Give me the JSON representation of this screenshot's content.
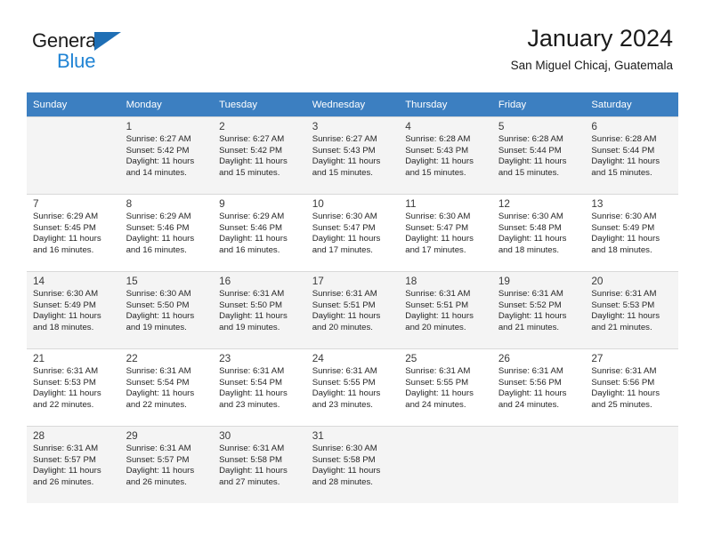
{
  "brand": {
    "name_top": "General",
    "name_bottom": "Blue",
    "triangle_color": "#1f6fb5",
    "blue_color": "#1f83d4"
  },
  "header": {
    "title": "January 2024",
    "subtitle": "San Miguel Chicaj, Guatemala"
  },
  "colors": {
    "header_row_bg": "#3c7fc1",
    "header_row_text": "#ffffff",
    "shaded_row_bg": "#f4f4f4",
    "grid_line": "#d9d9d9"
  },
  "weekdays": [
    "Sunday",
    "Monday",
    "Tuesday",
    "Wednesday",
    "Thursday",
    "Friday",
    "Saturday"
  ],
  "labels": {
    "sunrise_prefix": "Sunrise:",
    "sunset_prefix": "Sunset:",
    "daylight_prefix": "Daylight:"
  },
  "weeks": [
    {
      "shaded": true,
      "days": [
        {
          "num": "",
          "sunrise": "",
          "sunset": "",
          "daylight_line1": "",
          "daylight_line2": ""
        },
        {
          "num": "1",
          "sunrise": "Sunrise: 6:27 AM",
          "sunset": "Sunset: 5:42 PM",
          "daylight_line1": "Daylight: 11 hours",
          "daylight_line2": "and 14 minutes."
        },
        {
          "num": "2",
          "sunrise": "Sunrise: 6:27 AM",
          "sunset": "Sunset: 5:42 PM",
          "daylight_line1": "Daylight: 11 hours",
          "daylight_line2": "and 15 minutes."
        },
        {
          "num": "3",
          "sunrise": "Sunrise: 6:27 AM",
          "sunset": "Sunset: 5:43 PM",
          "daylight_line1": "Daylight: 11 hours",
          "daylight_line2": "and 15 minutes."
        },
        {
          "num": "4",
          "sunrise": "Sunrise: 6:28 AM",
          "sunset": "Sunset: 5:43 PM",
          "daylight_line1": "Daylight: 11 hours",
          "daylight_line2": "and 15 minutes."
        },
        {
          "num": "5",
          "sunrise": "Sunrise: 6:28 AM",
          "sunset": "Sunset: 5:44 PM",
          "daylight_line1": "Daylight: 11 hours",
          "daylight_line2": "and 15 minutes."
        },
        {
          "num": "6",
          "sunrise": "Sunrise: 6:28 AM",
          "sunset": "Sunset: 5:44 PM",
          "daylight_line1": "Daylight: 11 hours",
          "daylight_line2": "and 15 minutes."
        }
      ]
    },
    {
      "shaded": false,
      "days": [
        {
          "num": "7",
          "sunrise": "Sunrise: 6:29 AM",
          "sunset": "Sunset: 5:45 PM",
          "daylight_line1": "Daylight: 11 hours",
          "daylight_line2": "and 16 minutes."
        },
        {
          "num": "8",
          "sunrise": "Sunrise: 6:29 AM",
          "sunset": "Sunset: 5:46 PM",
          "daylight_line1": "Daylight: 11 hours",
          "daylight_line2": "and 16 minutes."
        },
        {
          "num": "9",
          "sunrise": "Sunrise: 6:29 AM",
          "sunset": "Sunset: 5:46 PM",
          "daylight_line1": "Daylight: 11 hours",
          "daylight_line2": "and 16 minutes."
        },
        {
          "num": "10",
          "sunrise": "Sunrise: 6:30 AM",
          "sunset": "Sunset: 5:47 PM",
          "daylight_line1": "Daylight: 11 hours",
          "daylight_line2": "and 17 minutes."
        },
        {
          "num": "11",
          "sunrise": "Sunrise: 6:30 AM",
          "sunset": "Sunset: 5:47 PM",
          "daylight_line1": "Daylight: 11 hours",
          "daylight_line2": "and 17 minutes."
        },
        {
          "num": "12",
          "sunrise": "Sunrise: 6:30 AM",
          "sunset": "Sunset: 5:48 PM",
          "daylight_line1": "Daylight: 11 hours",
          "daylight_line2": "and 18 minutes."
        },
        {
          "num": "13",
          "sunrise": "Sunrise: 6:30 AM",
          "sunset": "Sunset: 5:49 PM",
          "daylight_line1": "Daylight: 11 hours",
          "daylight_line2": "and 18 minutes."
        }
      ]
    },
    {
      "shaded": true,
      "days": [
        {
          "num": "14",
          "sunrise": "Sunrise: 6:30 AM",
          "sunset": "Sunset: 5:49 PM",
          "daylight_line1": "Daylight: 11 hours",
          "daylight_line2": "and 18 minutes."
        },
        {
          "num": "15",
          "sunrise": "Sunrise: 6:30 AM",
          "sunset": "Sunset: 5:50 PM",
          "daylight_line1": "Daylight: 11 hours",
          "daylight_line2": "and 19 minutes."
        },
        {
          "num": "16",
          "sunrise": "Sunrise: 6:31 AM",
          "sunset": "Sunset: 5:50 PM",
          "daylight_line1": "Daylight: 11 hours",
          "daylight_line2": "and 19 minutes."
        },
        {
          "num": "17",
          "sunrise": "Sunrise: 6:31 AM",
          "sunset": "Sunset: 5:51 PM",
          "daylight_line1": "Daylight: 11 hours",
          "daylight_line2": "and 20 minutes."
        },
        {
          "num": "18",
          "sunrise": "Sunrise: 6:31 AM",
          "sunset": "Sunset: 5:51 PM",
          "daylight_line1": "Daylight: 11 hours",
          "daylight_line2": "and 20 minutes."
        },
        {
          "num": "19",
          "sunrise": "Sunrise: 6:31 AM",
          "sunset": "Sunset: 5:52 PM",
          "daylight_line1": "Daylight: 11 hours",
          "daylight_line2": "and 21 minutes."
        },
        {
          "num": "20",
          "sunrise": "Sunrise: 6:31 AM",
          "sunset": "Sunset: 5:53 PM",
          "daylight_line1": "Daylight: 11 hours",
          "daylight_line2": "and 21 minutes."
        }
      ]
    },
    {
      "shaded": false,
      "days": [
        {
          "num": "21",
          "sunrise": "Sunrise: 6:31 AM",
          "sunset": "Sunset: 5:53 PM",
          "daylight_line1": "Daylight: 11 hours",
          "daylight_line2": "and 22 minutes."
        },
        {
          "num": "22",
          "sunrise": "Sunrise: 6:31 AM",
          "sunset": "Sunset: 5:54 PM",
          "daylight_line1": "Daylight: 11 hours",
          "daylight_line2": "and 22 minutes."
        },
        {
          "num": "23",
          "sunrise": "Sunrise: 6:31 AM",
          "sunset": "Sunset: 5:54 PM",
          "daylight_line1": "Daylight: 11 hours",
          "daylight_line2": "and 23 minutes."
        },
        {
          "num": "24",
          "sunrise": "Sunrise: 6:31 AM",
          "sunset": "Sunset: 5:55 PM",
          "daylight_line1": "Daylight: 11 hours",
          "daylight_line2": "and 23 minutes."
        },
        {
          "num": "25",
          "sunrise": "Sunrise: 6:31 AM",
          "sunset": "Sunset: 5:55 PM",
          "daylight_line1": "Daylight: 11 hours",
          "daylight_line2": "and 24 minutes."
        },
        {
          "num": "26",
          "sunrise": "Sunrise: 6:31 AM",
          "sunset": "Sunset: 5:56 PM",
          "daylight_line1": "Daylight: 11 hours",
          "daylight_line2": "and 24 minutes."
        },
        {
          "num": "27",
          "sunrise": "Sunrise: 6:31 AM",
          "sunset": "Sunset: 5:56 PM",
          "daylight_line1": "Daylight: 11 hours",
          "daylight_line2": "and 25 minutes."
        }
      ]
    },
    {
      "shaded": true,
      "days": [
        {
          "num": "28",
          "sunrise": "Sunrise: 6:31 AM",
          "sunset": "Sunset: 5:57 PM",
          "daylight_line1": "Daylight: 11 hours",
          "daylight_line2": "and 26 minutes."
        },
        {
          "num": "29",
          "sunrise": "Sunrise: 6:31 AM",
          "sunset": "Sunset: 5:57 PM",
          "daylight_line1": "Daylight: 11 hours",
          "daylight_line2": "and 26 minutes."
        },
        {
          "num": "30",
          "sunrise": "Sunrise: 6:31 AM",
          "sunset": "Sunset: 5:58 PM",
          "daylight_line1": "Daylight: 11 hours",
          "daylight_line2": "and 27 minutes."
        },
        {
          "num": "31",
          "sunrise": "Sunrise: 6:30 AM",
          "sunset": "Sunset: 5:58 PM",
          "daylight_line1": "Daylight: 11 hours",
          "daylight_line2": "and 28 minutes."
        },
        {
          "num": "",
          "sunrise": "",
          "sunset": "",
          "daylight_line1": "",
          "daylight_line2": ""
        },
        {
          "num": "",
          "sunrise": "",
          "sunset": "",
          "daylight_line1": "",
          "daylight_line2": ""
        },
        {
          "num": "",
          "sunrise": "",
          "sunset": "",
          "daylight_line1": "",
          "daylight_line2": ""
        }
      ]
    }
  ]
}
